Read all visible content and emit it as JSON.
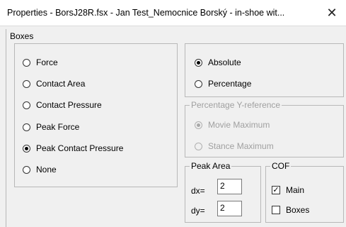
{
  "window": {
    "title": "Properties - BorsJ28R.fsx - Jan Test_Nemocnice Borský - in-shoe wit...",
    "close_icon": "close-icon"
  },
  "boxes_group": {
    "label": "Boxes",
    "options": [
      {
        "label": "Force",
        "checked": false
      },
      {
        "label": "Contact Area",
        "checked": false
      },
      {
        "label": "Contact Pressure",
        "checked": false
      },
      {
        "label": "Peak Force",
        "checked": false
      },
      {
        "label": "Peak Contact Pressure",
        "checked": true
      },
      {
        "label": "None",
        "checked": false
      }
    ]
  },
  "mode_group": {
    "options": [
      {
        "label": "Absolute",
        "checked": true
      },
      {
        "label": "Percentage",
        "checked": false
      }
    ]
  },
  "yref_group": {
    "label": "Percentage Y-reference",
    "disabled": true,
    "options": [
      {
        "label": "Movie Maximum",
        "checked": true
      },
      {
        "label": "Stance Maximum",
        "checked": false
      }
    ]
  },
  "peak_area_group": {
    "label": "Peak Area",
    "dx_label": "dx=",
    "dx_value": "2",
    "dy_label": "dy=",
    "dy_value": "2"
  },
  "cof_group": {
    "label": "COF",
    "main_label": "Main",
    "main_checked": true,
    "boxes_label": "Boxes",
    "boxes_checked": false
  }
}
